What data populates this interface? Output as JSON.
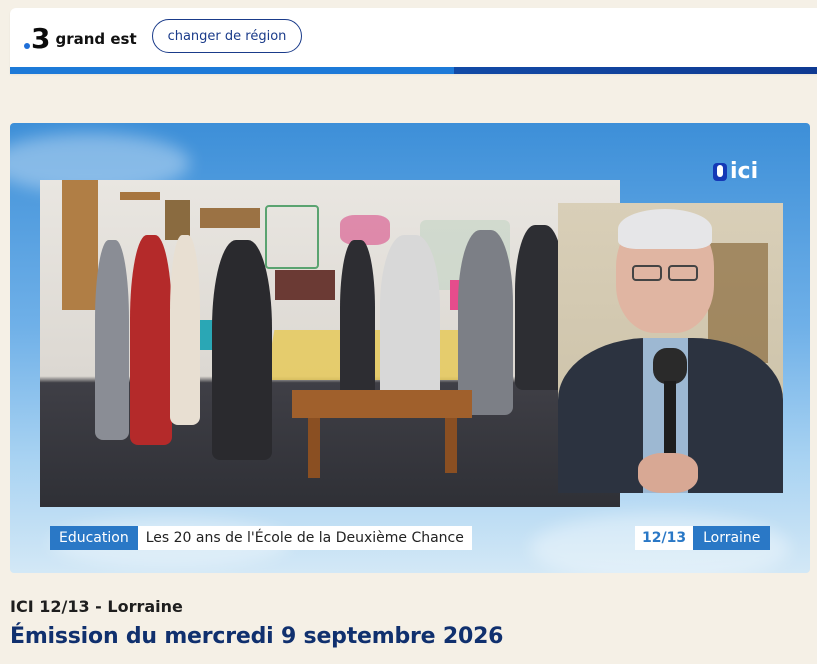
{
  "header": {
    "logo_number": "3",
    "logo_text": "grand est",
    "region_button": "changer de région"
  },
  "video": {
    "overlay_logo": "ici",
    "caption": {
      "tag": "Education",
      "title": "Les 20 ans de l'École de la Deuxième Chance",
      "show": "12/13",
      "region": "Lorraine"
    }
  },
  "program": {
    "show_name": "ICI 12/13 - Lorraine",
    "episode_title": "Émission du mercredi 9 septembre 2026"
  },
  "colors": {
    "accent_blue": "#2a78c6",
    "title_navy": "#10306e",
    "page_bg": "#f5f0e6"
  }
}
